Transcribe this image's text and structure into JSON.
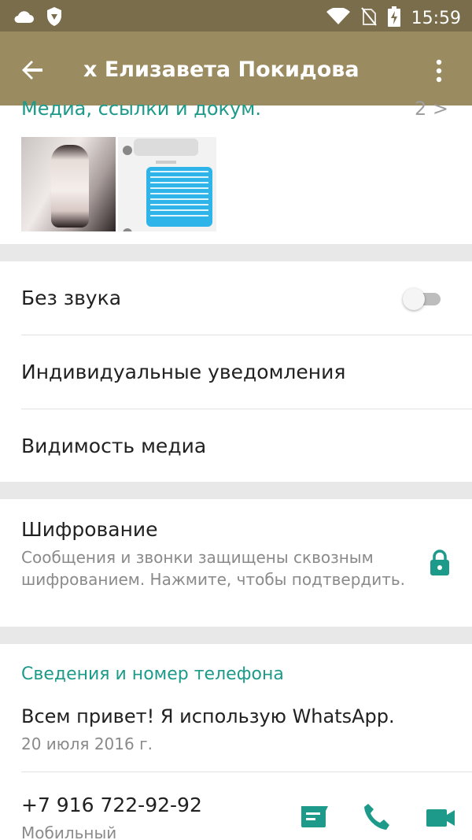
{
  "status_bar": {
    "time": "15:59",
    "icons": [
      "cloud-icon",
      "shield-icon",
      "wifi-icon",
      "no-sim-icon",
      "battery-charging-icon"
    ]
  },
  "app_bar": {
    "title": "x Елизавета Покидова",
    "icons": [
      "back-arrow-icon",
      "more-vert-icon"
    ]
  },
  "media": {
    "title": "Медиа, ссылки и докум.",
    "count": "2 >"
  },
  "settings": {
    "mute_label": "Без звука",
    "mute_enabled": false,
    "custom_notifications_label": "Индивидуальные уведомления",
    "media_visibility_label": "Видимость медиа"
  },
  "encryption": {
    "title": "Шифрование",
    "description": "Сообщения и звонки защищены сквозным шифрованием. Нажмите, чтобы подтвердить."
  },
  "info": {
    "header": "Сведения и номер телефона",
    "about": "Всем привет! Я использую WhatsApp.",
    "about_date": "20 июля 2016 г.",
    "phone": "+7 916 722-92-92",
    "phone_type": "Мобильный"
  },
  "colors": {
    "app_bar": "#9a8b60",
    "status_bar": "#7a6d4c",
    "accent": "#1d9a8a"
  }
}
